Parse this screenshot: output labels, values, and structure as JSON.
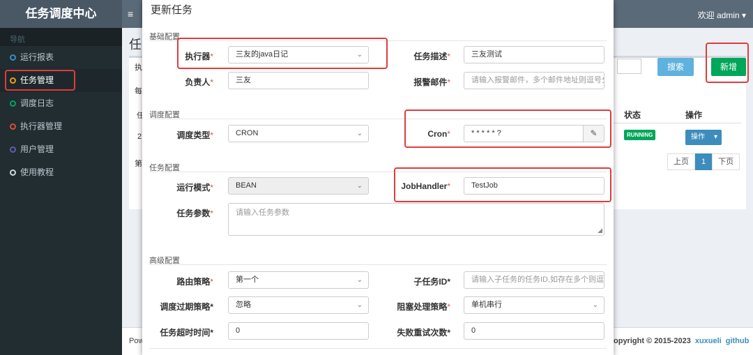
{
  "header": {
    "brand": "任务调度中心",
    "menu_icon": "≡",
    "welcome": "欢迎 admin ▾"
  },
  "sidebar": {
    "header": "导航",
    "items": [
      {
        "label": "运行报表",
        "color": "#3c8dbc"
      },
      {
        "label": "任务管理",
        "color": "#f39c12"
      },
      {
        "label": "调度日志",
        "color": "#00a65a"
      },
      {
        "label": "执行器管理",
        "color": "#dd4b39"
      },
      {
        "label": "用户管理",
        "color": "#605ca8"
      },
      {
        "label": "使用教程",
        "color": "#d2d6de"
      }
    ]
  },
  "background": {
    "page_title": "任",
    "row_prefix": "执",
    "each_prefix": "每",
    "tiny_prefix": "任",
    "row_num": "2",
    "page_prefix": "第",
    "search_button": "搜索",
    "add_button": "新增",
    "columns": {
      "status": "状态",
      "operation": "操作"
    },
    "row": {
      "status": "RUNNING",
      "op_button": "操作",
      "op_caret": "▾"
    },
    "pager": {
      "prev": "上页",
      "current": "1",
      "next": "下页"
    },
    "footer_left": "Pow",
    "footer_copy": "opyright © 2015-2023",
    "footer_link1": "xuxueli",
    "footer_link2": "github"
  },
  "modal": {
    "title": "更新任务",
    "sections": {
      "basic": "基础配置",
      "schedule": "调度配置",
      "task": "任务配置",
      "advanced": "高级配置"
    },
    "fields": {
      "executor": {
        "label": "执行器",
        "value": "三友的java日记"
      },
      "job_desc": {
        "label": "任务描述",
        "value": "三友测试"
      },
      "owner": {
        "label": "负责人",
        "value": "三友"
      },
      "alarm_email": {
        "label": "报警邮件",
        "placeholder": "请输入报警邮件，多个邮件地址则逗号分"
      },
      "schedule_type": {
        "label": "调度类型",
        "value": "CRON"
      },
      "cron": {
        "label": "Cron",
        "value": "* * * * * ?",
        "edit_icon": "✎"
      },
      "run_mode": {
        "label": "运行模式",
        "value": "BEAN"
      },
      "job_handler": {
        "label": "JobHandler",
        "value": "TestJob"
      },
      "job_param": {
        "label": "任务参数",
        "placeholder": "请输入任务参数"
      },
      "route_strategy": {
        "label": "路由策略",
        "value": "第一个"
      },
      "child_job_id": {
        "label": "子任务ID",
        "placeholder": "请输入子任务的任务ID,如存在多个则逗"
      },
      "misfire_strategy": {
        "label": "调度过期策略",
        "value": "忽略"
      },
      "block_strategy": {
        "label": "阻塞处理策略",
        "value": "单机串行"
      },
      "timeout": {
        "label": "任务超时时间",
        "value": "0"
      },
      "retry_count": {
        "label": "失败重试次数",
        "value": "0"
      }
    },
    "required_mark": "*",
    "select_chevron": "⌄"
  }
}
